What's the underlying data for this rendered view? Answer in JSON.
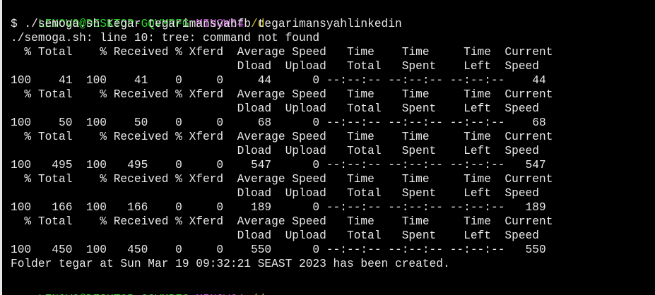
{
  "colors": {
    "background": "#000000",
    "text": "#e8e8e8",
    "prompt_user": "#2bd42b",
    "prompt_env": "#c34bd2",
    "prompt_path": "#d2c22b"
  },
  "prompt": {
    "user_host": "LENOVO@DESKTOP-GQVMRFG",
    "env": "MINGW64",
    "path": "/d"
  },
  "command": "$ ./semoga.sh tegar tegarimansyahfb tegarimansyahlinkedin",
  "error_line": "./semoga.sh: line 10: tree: command not found",
  "curl_blocks": [
    {
      "header1": "  % Total    % Received % Xferd  Average Speed   Time    Time     Time  Current",
      "header2": "                                 Dload  Upload   Total   Spent    Left  Speed",
      "progress": "100    41  100    41    0     0     44      0 --:--:-- --:--:-- --:--:--    44"
    },
    {
      "header1": "  % Total    % Received % Xferd  Average Speed   Time    Time     Time  Current",
      "header2": "                                 Dload  Upload   Total   Spent    Left  Speed",
      "progress": "100    50  100    50    0     0     68      0 --:--:-- --:--:-- --:--:--    68"
    },
    {
      "header1": "  % Total    % Received % Xferd  Average Speed   Time    Time     Time  Current",
      "header2": "                                 Dload  Upload   Total   Spent    Left  Speed",
      "progress": "100   495  100   495    0     0    547      0 --:--:-- --:--:-- --:--:--   547"
    },
    {
      "header1": "  % Total    % Received % Xferd  Average Speed   Time    Time     Time  Current",
      "header2": "                                 Dload  Upload   Total   Spent    Left  Speed",
      "progress": "100   166  100   166    0     0    189      0 --:--:-- --:--:-- --:--:--   189"
    },
    {
      "header1": "  % Total    % Received % Xferd  Average Speed   Time    Time     Time  Current",
      "header2": "                                 Dload  Upload   Total   Spent    Left  Speed",
      "progress": "100   450  100   450    0     0    550      0 --:--:-- --:--:-- --:--:--   550"
    }
  ],
  "result_line": "Folder tegar at Sun Mar 19 09:32:21 SEAST 2023 has been created."
}
